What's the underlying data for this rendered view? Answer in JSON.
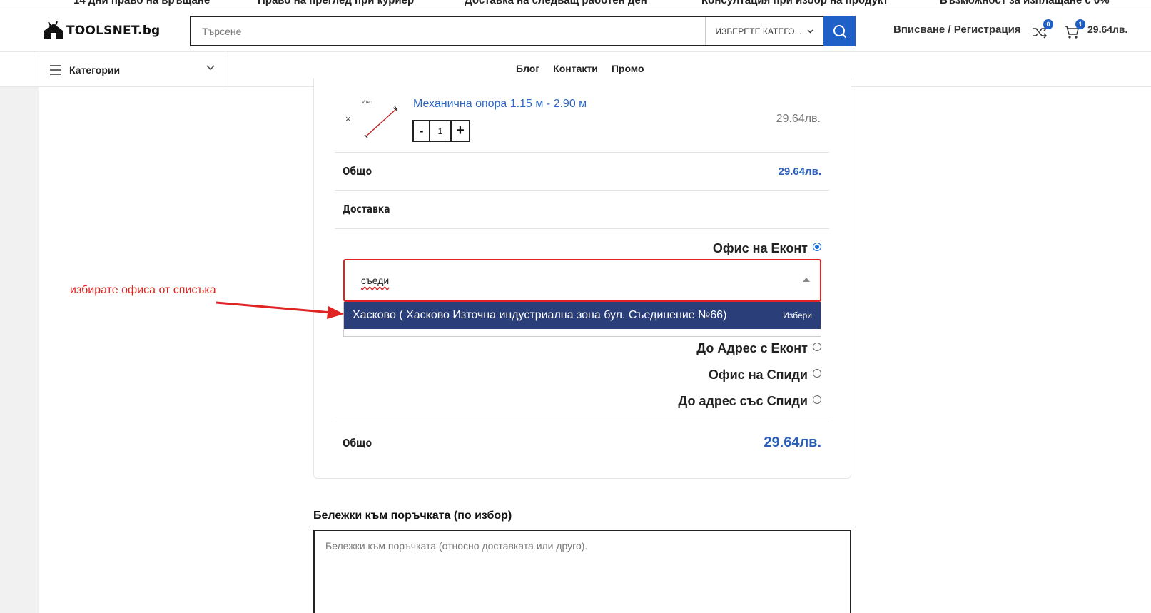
{
  "promo": {
    "items": [
      "14 дни право на връщане",
      "Право на преглед при куриер",
      "Доставка на следващ работен ден",
      "Консултация при избор на продукт",
      "Възможност за изплащане с 0%"
    ]
  },
  "header": {
    "logo_text": "TOOLSNET.bg",
    "search_placeholder": "Търсене",
    "category_select": "ИЗБЕРЕТЕ КАТЕГО...",
    "login_label": "Вписване / Регистрация",
    "compare_count": "0",
    "cart_count": "1",
    "cart_total": "29.64лв."
  },
  "nav": {
    "categories_label": "Категории",
    "links": [
      "Блог",
      "Контакти",
      "Промо"
    ]
  },
  "order": {
    "product": {
      "remove": "×",
      "title": "Механична опора 1.15 м - 2.90 м",
      "qty_minus": "-",
      "qty": "1",
      "qty_plus": "+",
      "price": "29.64лв."
    },
    "subtotal_label": "Общо",
    "subtotal_value": "29.64лв.",
    "shipping_label": "Доставка",
    "shipping_options": [
      {
        "label": "Офис на Еконт",
        "selected": true
      },
      {
        "label": "До Адрес с Еконт",
        "selected": false
      },
      {
        "label": "Офис на Спиди",
        "selected": false
      },
      {
        "label": "До адрес със Спиди",
        "selected": false
      }
    ],
    "office_search_value": "съеди",
    "office_result": "Хасково ( Хасково Източна индустриална зона бул. Съединение №66)",
    "office_result_action": "Избери",
    "total_label": "Общо",
    "total_value": "29.64лв."
  },
  "annotation": {
    "text": "избирате офиса от списъка",
    "color": "#e02424"
  },
  "notes": {
    "label": "Бележки към поръчката (по избор)",
    "placeholder": "Бележки към поръчката (относно доставката или друго)."
  },
  "colors": {
    "accent": "#1f5fc8",
    "price": "#2b5fb8",
    "link": "#2b67c4",
    "dropdown_highlight": "#2a3f7a"
  }
}
